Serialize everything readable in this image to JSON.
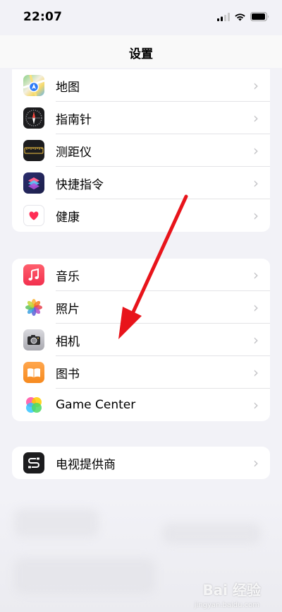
{
  "status_bar": {
    "time": "22:07"
  },
  "nav": {
    "title": "设置"
  },
  "groups": [
    {
      "items": [
        {
          "label": "地图",
          "icon": "maps-icon"
        },
        {
          "label": "指南针",
          "icon": "compass-icon"
        },
        {
          "label": "测距仪",
          "icon": "measure-icon"
        },
        {
          "label": "快捷指令",
          "icon": "shortcuts-icon"
        },
        {
          "label": "健康",
          "icon": "health-icon"
        }
      ]
    },
    {
      "items": [
        {
          "label": "音乐",
          "icon": "music-icon"
        },
        {
          "label": "照片",
          "icon": "photos-icon"
        },
        {
          "label": "相机",
          "icon": "camera-icon"
        },
        {
          "label": "图书",
          "icon": "books-icon"
        },
        {
          "label": "Game Center",
          "icon": "game-center-icon"
        }
      ]
    },
    {
      "items": [
        {
          "label": "电视提供商",
          "icon": "tv-provider-icon"
        }
      ]
    }
  ],
  "annotation": {
    "color": "#e8141b",
    "points_to": "相机"
  },
  "watermark": {
    "text": "Bai 经验",
    "sub": "jingyan.baidu.com"
  },
  "colors": {
    "background": "#f2f2f7",
    "cell": "#ffffff",
    "chevron": "#c4c4c7"
  }
}
